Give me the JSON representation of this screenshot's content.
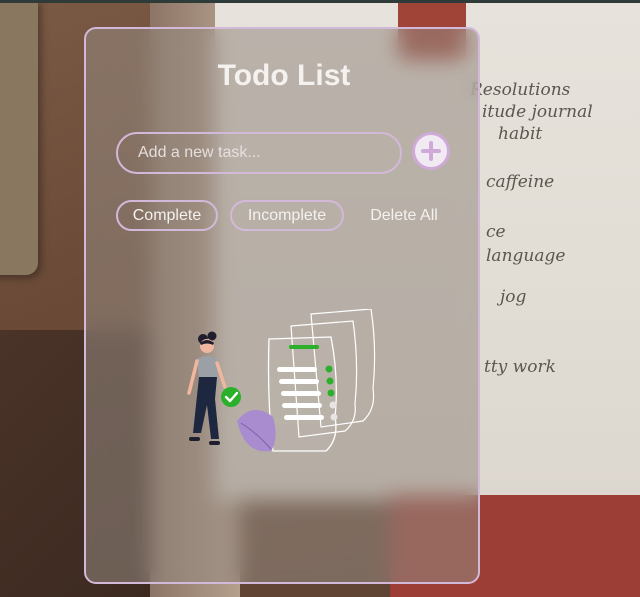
{
  "app": {
    "title": "Todo List"
  },
  "input": {
    "placeholder": "Add a new task...",
    "value": ""
  },
  "add_button": {
    "icon": "plus-icon"
  },
  "filters": {
    "complete": "Complete",
    "incomplete": "Incomplete",
    "delete_all": "Delete All"
  },
  "background_handwriting": [
    "Resolutions",
    "itude journal",
    "habit",
    "caffeine",
    "ce",
    "language",
    "jog",
    "tty work"
  ],
  "colors": {
    "card_border": "#d2b8d9",
    "add_button_accent": "#cfa9d8",
    "check_green": "#2bb02b",
    "leaf_purple": "#a98bd0",
    "text": "#f4f1ef"
  },
  "illustration": {
    "icon": "empty-list-illustration"
  }
}
